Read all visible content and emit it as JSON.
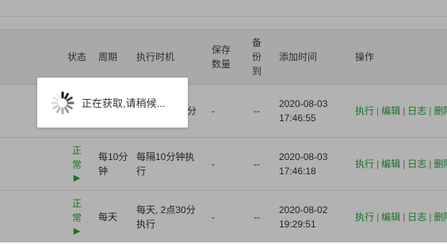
{
  "table": {
    "headers": {
      "status": "状态",
      "cycle": "周期",
      "exec_time": "执行时机",
      "keep_count": "保存数量",
      "backup_to": "备份到",
      "added_time": "添加时间",
      "ops": "操作"
    },
    "rows": [
      {
        "status": "",
        "cycle": "",
        "exec_time": "",
        "exec_time_suffix": "分",
        "keep": "-",
        "backup": "--",
        "added_date": "2020-08-03",
        "added_clock": "17:46:55"
      },
      {
        "status": "正常",
        "cycle": "每10分钟",
        "exec_time": "每隔10分钟执行",
        "keep": "-",
        "backup": "--",
        "added_date": "2020-08-03",
        "added_clock": "17:46:18"
      },
      {
        "status": "正常",
        "cycle": "每天",
        "exec_time": "每天, 2点30分执行",
        "keep": "-",
        "backup": "--",
        "added_date": "2020-08-02",
        "added_clock": "19:29:51"
      }
    ],
    "ops": {
      "run": "执行",
      "edit": "编辑",
      "log": "日志",
      "delete": "删除"
    },
    "separator": "|",
    "play_symbol": "▶"
  },
  "loading": {
    "text": "正在获取,请稍候..."
  },
  "colors": {
    "accent": "#20a53a",
    "overlay": "rgba(0,0,0,0.3)"
  }
}
